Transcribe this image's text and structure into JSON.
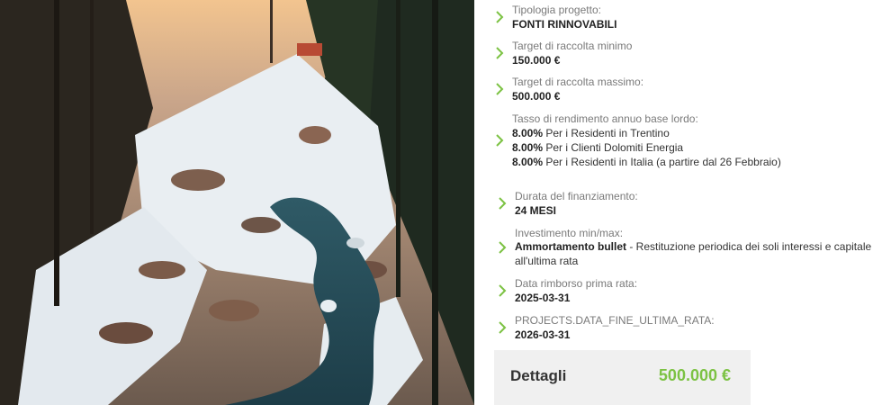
{
  "project": {
    "tipologia": {
      "label": "Tipologia progetto:",
      "value": "FONTI RINNOVABILI"
    },
    "target_min": {
      "label": "Target di raccolta minimo",
      "value": "150.000 €"
    },
    "target_max": {
      "label": "Target di raccolta massimo:",
      "value": "500.000 €"
    },
    "rendimento": {
      "label": "Tasso di rendimento annuo base lordo:",
      "rates": [
        {
          "rate": "8.00%",
          "text": " Per i Residenti in Trentino"
        },
        {
          "rate": "8.00%",
          "text": " Per i Clienti Dolomiti Energia"
        },
        {
          "rate": "8.00%",
          "text": " Per i Residenti in Italia (a partire dal 26 Febbraio)"
        }
      ]
    },
    "durata": {
      "label": "Durata del finanziamento:",
      "value": "24 MESI"
    },
    "investimento": {
      "label": "Investimento min/max:",
      "bold": "Ammortamento bullet",
      "text": " - Restituzione periodica dei soli interessi e capitale all'ultima rata"
    },
    "prima_rata": {
      "label": "Data rimborso prima rata:",
      "value": "2025-03-31"
    },
    "ultima_rata": {
      "label": "PROJECTS.DATA_FINE_ULTIMA_RATA:",
      "value": "2026-03-31"
    }
  },
  "details": {
    "label": "Dettagli",
    "amount": "500.000 €"
  },
  "icons": {
    "bullet": "chevron-right-icon"
  },
  "colors": {
    "accent": "#7cc243",
    "label": "#7a7a7a",
    "details_bg": "#f0f0f0"
  }
}
